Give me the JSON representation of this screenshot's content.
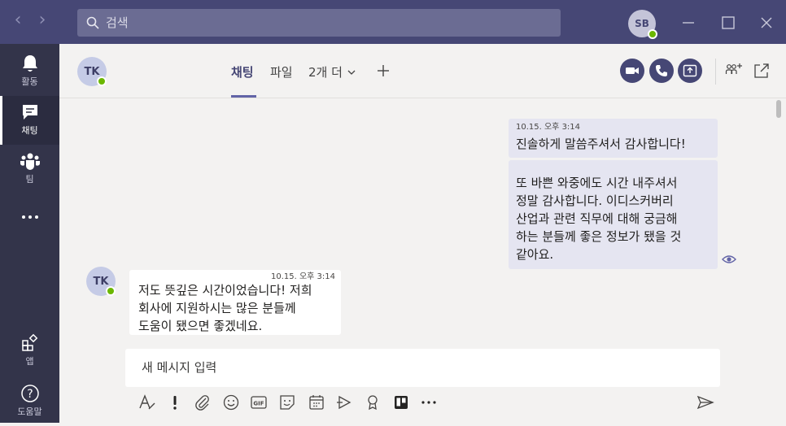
{
  "titlebar": {
    "search_placeholder": "검색",
    "user_initials": "SB"
  },
  "rail": {
    "items": [
      {
        "label": "활동",
        "icon": "bell-icon"
      },
      {
        "label": "채팅",
        "icon": "chat-icon"
      },
      {
        "label": "팀",
        "icon": "teams-icon"
      },
      {
        "label": "",
        "icon": "more-icon"
      },
      {
        "label": "앱",
        "icon": "apps-icon"
      },
      {
        "label": "도움말",
        "icon": "help-icon"
      }
    ]
  },
  "chat": {
    "contact_initials": "TK",
    "tabs": [
      "채팅",
      "파일",
      "2개 더"
    ],
    "active_tab": "채팅"
  },
  "messages": [
    {
      "direction": "out",
      "time": "10.15. 오후 3:14",
      "lines": [
        "진솔하게 말씀주셔서 감사합니다!"
      ]
    },
    {
      "direction": "out",
      "time": "",
      "lines": [
        "또 바쁜 와중에도 시간 내주셔서",
        "정말 감사합니다. 이디스커버리",
        "산업과 관련 직무에 대해 궁금해",
        "하는 분들께 좋은 정보가 됐을 것",
        "같아요."
      ]
    },
    {
      "direction": "in",
      "sender_initials": "TK",
      "time": "10.15. 오후 3:14",
      "lines": [
        "저도 뜻깊은 시간이었습니다! 저희",
        "회사에 지원하시는 많은 분들께",
        "도움이 됐으면 좋겠네요."
      ]
    }
  ],
  "compose": {
    "placeholder": "새 메시지 입력",
    "tools": [
      "format-icon",
      "important-icon",
      "attach-icon",
      "emoji-icon",
      "gif-icon",
      "sticker-icon",
      "schedule-meeting-icon",
      "stream-icon",
      "praise-icon",
      "trello-icon",
      "more-options-icon",
      "send-icon"
    ]
  },
  "colors": {
    "titlebar": "#464775",
    "rail": "#33344a",
    "accent": "#6264a7",
    "presence": "#6bb700",
    "outgoing_bubble": "#e5e5f1"
  }
}
